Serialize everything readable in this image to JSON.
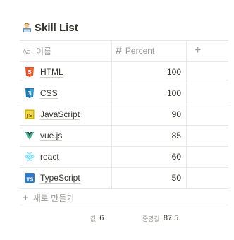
{
  "page": {
    "title": "Skill List",
    "title_icon": "technologist-icon"
  },
  "table": {
    "columns": [
      {
        "label": "이름",
        "icon": "text-type-icon"
      },
      {
        "label": "Percent",
        "icon": "number-hash-icon"
      }
    ],
    "add_column_icon": "plus-icon",
    "rows": [
      {
        "name": "HTML",
        "percent": "100",
        "icon": "html5-icon",
        "icon_color": "#e44d26"
      },
      {
        "name": "CSS",
        "percent": "100",
        "icon": "css3-icon",
        "icon_color": "#2965f1"
      },
      {
        "name": "JavaScript",
        "percent": "90",
        "icon": "javascript-icon",
        "icon_color": "#f0db4f"
      },
      {
        "name": "vue.js",
        "percent": "85",
        "icon": "vue-icon",
        "icon_color": "#41b883"
      },
      {
        "name": "react",
        "percent": "60",
        "icon": "react-icon",
        "icon_color": "#61dafb"
      },
      {
        "name": "TypeScript",
        "percent": "50",
        "icon": "typescript-icon",
        "icon_color": "#3178c6"
      }
    ],
    "new_row_label": "새로 만들기",
    "footer": {
      "count_label": "값",
      "count_value": "6",
      "average_label": "중앙값",
      "average_value": "87.5"
    }
  },
  "colors": {
    "text": "#37352f",
    "muted": "#9b9a97",
    "border": "#e9e9e7"
  }
}
